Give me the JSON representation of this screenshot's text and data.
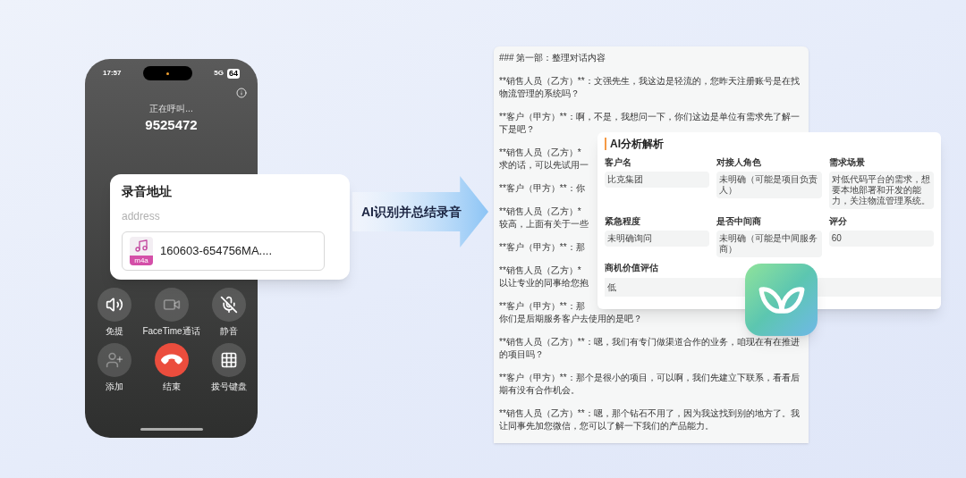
{
  "phone": {
    "time": "17:57",
    "network": "5G",
    "battery": "64",
    "call_status": "正在呼叫...",
    "number": "9525472",
    "buttons": [
      {
        "kind": "speaker",
        "label": "免提",
        "disabled": false
      },
      {
        "kind": "facetime",
        "label": "FaceTime通话",
        "disabled": true
      },
      {
        "kind": "mute",
        "label": "静音",
        "disabled": false
      },
      {
        "kind": "add",
        "label": "添加",
        "disabled": true
      },
      {
        "kind": "end",
        "label": "结束",
        "disabled": false
      },
      {
        "kind": "keypad",
        "label": "拨号键盘",
        "disabled": false
      }
    ]
  },
  "recording_card": {
    "title": "录音地址",
    "placeholder": "address",
    "file_type": "m4a",
    "file_name": "160603-654756MA...."
  },
  "arrow": {
    "label": "AI识别并总结录音"
  },
  "transcript": {
    "paragraphs": [
      [
        "### 第一部：整理对话内容"
      ],
      [
        "**销售人员（乙方）**：文强先生，我这边是轻流的，您昨天注册账号是在找",
        "物流管理的系统吗？"
      ],
      [
        "**客户（甲方）**：啊，不是，我想问一下，你们这边是单位有需求先了解一",
        "下是吧？"
      ],
      [
        "**销售人员（乙方）*",
        "求的话，可以先试用一"
      ],
      [
        "**客户（甲方）**：你"
      ],
      [
        "**销售人员（乙方）*",
        "较高，上面有关于一些"
      ],
      [
        "**客户（甲方）**：那"
      ],
      [
        "**销售人员（乙方）*",
        "以让专业的同事给您抱"
      ],
      [
        "**客户（甲方）**：那",
        "你们是后期服务客户去使用的是吧？"
      ],
      [
        "**销售人员（乙方）**：嗯，我们有专门做渠道合作的业务，咱现在有在推进",
        "的项目吗？"
      ],
      [
        "**客户（甲方）**：那个是很小的项目，可以啊，我们先建立下联系，看看后",
        "期有没有合作机会。"
      ],
      [
        "**销售人员（乙方）**：嗯，那个钻石不用了，因为我这找到别的地方了。我",
        "让同事先加您微信，您可以了解一下我们的产品能力。"
      ]
    ]
  },
  "analysis": {
    "title": "AI分析解析",
    "fields": [
      {
        "label": "客户名",
        "value": "比克集团"
      },
      {
        "label": "对接人角色",
        "value": "未明确（可能是项目负责人）"
      },
      {
        "label": "需求场景",
        "value": "对低代码平台的需求，想要本地部署和开发的能力，关注物流管理系统。"
      },
      {
        "label": "紧急程度",
        "value": "未明确询问"
      },
      {
        "label": "是否中间商",
        "value": "未明确（可能是中间服务商）"
      },
      {
        "label": "评分",
        "value": "60"
      }
    ],
    "wide_field": {
      "label": "商机价值评估",
      "value": "低"
    }
  }
}
